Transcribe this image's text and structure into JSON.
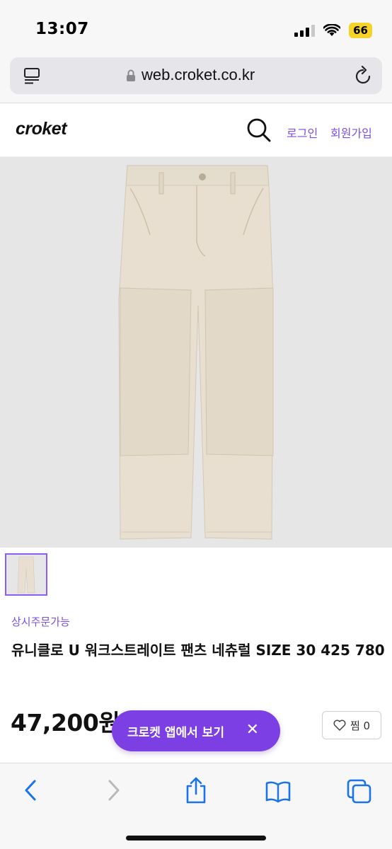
{
  "status_bar": {
    "time": "13:07",
    "battery": "66"
  },
  "browser": {
    "url": "web.croket.co.kr"
  },
  "site": {
    "logo": "croket",
    "login": "로그인",
    "signup": "회원가입"
  },
  "product": {
    "order_tag": "상시주문가능",
    "title": "유니클로 U 워크스트레이트 팬츠 네츄럴 SIZE 30 425 780",
    "price": "47,200원",
    "like_label": "찜 0"
  },
  "app_banner": {
    "label": "크로켓 앱에서 보기",
    "close": "✕"
  },
  "colors": {
    "accent": "#7b3fe4",
    "link": "#7b4fe0",
    "image_bg": "#e6e6e6",
    "pants": "#e8dfd0"
  },
  "icons": [
    "tabs-icon",
    "lock-icon",
    "reload-icon",
    "search-icon",
    "heart-icon",
    "back-icon",
    "forward-icon",
    "share-icon",
    "bookmarks-icon",
    "tabs-overview-icon"
  ]
}
